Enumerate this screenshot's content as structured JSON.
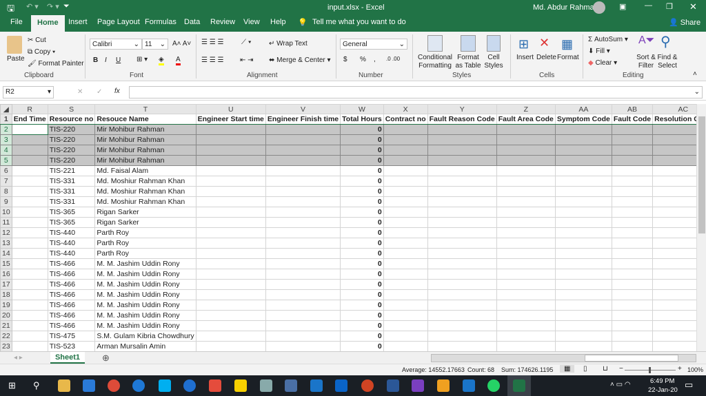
{
  "title": {
    "file": "input.xlsx  -  Excel",
    "user": "Md. Abdur Rahman"
  },
  "tabs": [
    "File",
    "Home",
    "Insert",
    "Page Layout",
    "Formulas",
    "Data",
    "Review",
    "View",
    "Help"
  ],
  "tell_me": "Tell me what you want to do",
  "share": "Share",
  "ribbon": {
    "clipboard": {
      "paste": "Paste",
      "cut": "Cut",
      "copy": "Copy",
      "format_painter": "Format Painter",
      "label": "Clipboard"
    },
    "font": {
      "name": "Calibri",
      "size": "11",
      "label": "Font",
      "bold": "B",
      "italic": "I",
      "underline": "U"
    },
    "alignment": {
      "wrap": "Wrap Text",
      "merge": "Merge & Center",
      "label": "Alignment"
    },
    "number": {
      "format": "General",
      "currency": "$",
      "percent": "%",
      "comma": ",",
      "label": "Number"
    },
    "styles": {
      "conditional": "Conditional Formatting",
      "format_table": "Format as Table",
      "cell_styles": "Cell Styles",
      "label": "Styles"
    },
    "cells": {
      "insert": "Insert",
      "delete": "Delete",
      "format": "Format",
      "label": "Cells"
    },
    "editing": {
      "autosum": "AutoSum",
      "fill": "Fill",
      "clear": "Clear",
      "sort": "Sort & Filter",
      "find": "Find & Select",
      "label": "Editing"
    }
  },
  "name_box": "R2",
  "fx": "fx",
  "columns": [
    "R",
    "S",
    "T",
    "U",
    "V",
    "W",
    "X",
    "Y",
    "Z",
    "AA",
    "AB",
    "AC"
  ],
  "headers": [
    "End Time",
    "Resource no",
    "Resouce Name",
    "Engineer Start time",
    "Engineer Finish time",
    "Total Hours",
    "Contract no",
    "Fault Reason Code",
    "Fault Area Code",
    "Symptom Code",
    "Fault Code",
    "Resolution Code"
  ],
  "rows": [
    {
      "n": "2",
      "s": "TIS-220",
      "t": "Mir Mohibur Rahman",
      "w": "0"
    },
    {
      "n": "3",
      "s": "TIS-220",
      "t": "Mir Mohibur Rahman",
      "w": "0"
    },
    {
      "n": "4",
      "s": "TIS-220",
      "t": "Mir Mohibur Rahman",
      "w": "0"
    },
    {
      "n": "5",
      "s": "TIS-220",
      "t": "Mir Mohibur Rahman",
      "w": "0"
    },
    {
      "n": "6",
      "s": "TIS-221",
      "t": "Md. Faisal Alam",
      "w": "0"
    },
    {
      "n": "7",
      "s": "TIS-331",
      "t": "Md. Moshiur Rahman Khan",
      "w": "0"
    },
    {
      "n": "8",
      "s": "TIS-331",
      "t": "Md. Moshiur Rahman Khan",
      "w": "0"
    },
    {
      "n": "9",
      "s": "TIS-331",
      "t": "Md. Moshiur Rahman Khan",
      "w": "0"
    },
    {
      "n": "10",
      "s": "TIS-365",
      "t": "Rigan Sarker",
      "w": "0"
    },
    {
      "n": "11",
      "s": "TIS-365",
      "t": "Rigan Sarker",
      "w": "0"
    },
    {
      "n": "12",
      "s": "TIS-440",
      "t": "Parth Roy",
      "w": "0"
    },
    {
      "n": "13",
      "s": "TIS-440",
      "t": "Parth Roy",
      "w": "0"
    },
    {
      "n": "14",
      "s": "TIS-440",
      "t": "Parth Roy",
      "w": "0"
    },
    {
      "n": "15",
      "s": "TIS-466",
      "t": "M. M. Jashim Uddin Rony",
      "w": "0"
    },
    {
      "n": "16",
      "s": "TIS-466",
      "t": "M. M. Jashim Uddin Rony",
      "w": "0"
    },
    {
      "n": "17",
      "s": "TIS-466",
      "t": "M. M. Jashim Uddin Rony",
      "w": "0"
    },
    {
      "n": "18",
      "s": "TIS-466",
      "t": "M. M. Jashim Uddin Rony",
      "w": "0"
    },
    {
      "n": "19",
      "s": "TIS-466",
      "t": "M. M. Jashim Uddin Rony",
      "w": "0"
    },
    {
      "n": "20",
      "s": "TIS-466",
      "t": "M. M. Jashim Uddin Rony",
      "w": "0"
    },
    {
      "n": "21",
      "s": "TIS-466",
      "t": "M. M. Jashim Uddin Rony",
      "w": "0"
    },
    {
      "n": "22",
      "s": "TIS-475",
      "t": "S.M. Gulam Kibria Chowdhury",
      "w": "0"
    },
    {
      "n": "23",
      "s": "TIS-523",
      "t": "Arman Mursalin Amin",
      "w": "0"
    }
  ],
  "sheet_tab": "Sheet1",
  "status": {
    "average": "Average: 14552.17663",
    "count": "Count: 68",
    "sum": "Sum: 174626.1195",
    "zoom": "100%"
  },
  "clock": {
    "time": "6:49 PM",
    "date": "22-Jan-20"
  },
  "colors": {
    "accent": "#217346"
  }
}
